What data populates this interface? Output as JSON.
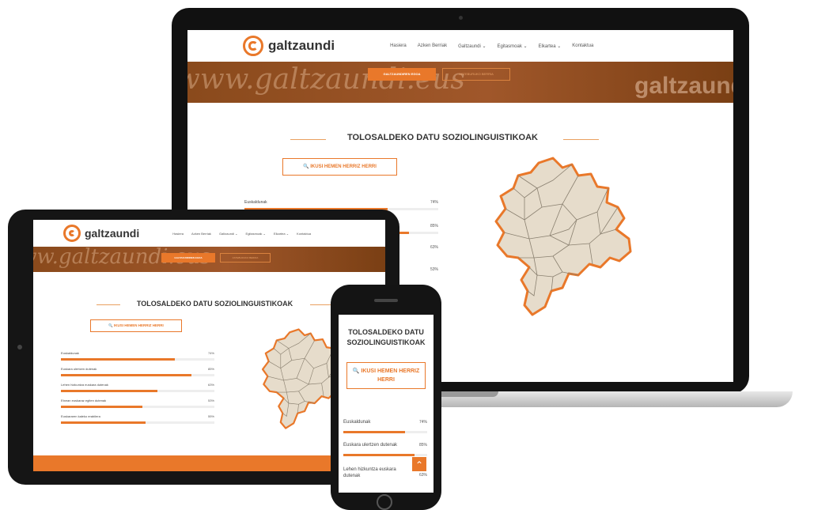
{
  "brand": {
    "name": "galtzaundi",
    "watermark": "www.galtzaundi.eus",
    "banner_brand": "galtzaund",
    "accent": "#e9782a",
    "banner_color": "#8a4a1c"
  },
  "menu": [
    "Hasiera",
    "Azken Berriak",
    "Galtzaundi ⌄",
    "Egitasmoak ⌄",
    "Elkartea ⌄",
    "Kontaktua"
  ],
  "banner_buttons": {
    "primary": "GALTZAUNDIREN EGOA",
    "secondary": "ASTEBURUKO BERRIA"
  },
  "section": {
    "title": "TOLOSALDEKO DATU SOZIOLINGUISTIKOAK",
    "phone_title": "TOLOSALDEKO DATU SOZIOLINGUISTIKOAK",
    "button": "🔍 IKUSI HEMEN HERRIZ HERRI",
    "phone_button": "🔍 IKUSI HEMEN HERRIZ HERRI"
  },
  "stats": [
    {
      "label": "Euskaldunak",
      "value": "74%",
      "fraction": 0.74
    },
    {
      "label": "Euskara ulertzen dutenak",
      "value": "85%",
      "fraction": 0.85
    },
    {
      "label": "Lehen hizkuntza euskara dutenak",
      "value": "63%",
      "fraction": 0.63
    },
    {
      "label": "Etxean euskaraz egiten dutenak",
      "value": "53%",
      "fraction": 0.53
    },
    {
      "label": "Euskararen kaleko erabilera",
      "value": "55%",
      "fraction": 0.55
    }
  ],
  "icons": {
    "logo": "spiral-logo-icon",
    "search": "search-icon",
    "scroll_top": "chevron-up-icon"
  }
}
